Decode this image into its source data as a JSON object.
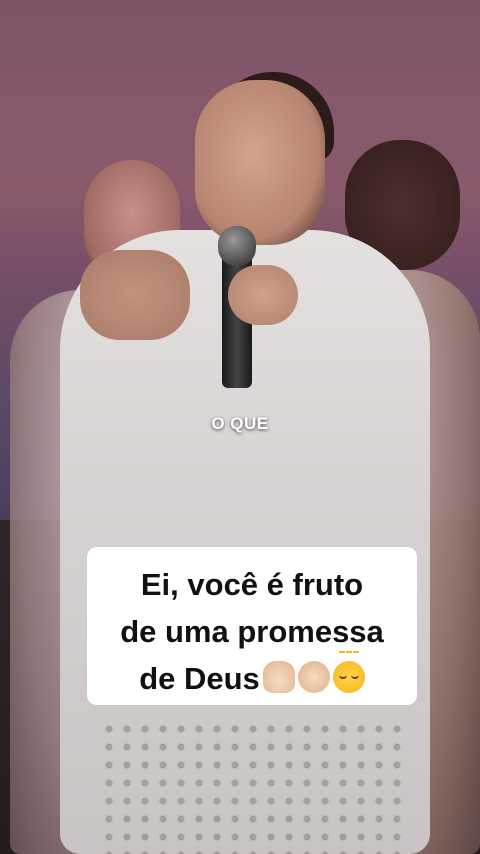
{
  "video": {
    "spoken_subtitle": "O QUE"
  },
  "caption": {
    "line1": "Ei, você é fruto",
    "line2": "de uma promessa",
    "line3": "de Deus",
    "emojis": [
      "raising-hands-icon",
      "pointing-hand-icon",
      "relieved-face-icon"
    ]
  }
}
